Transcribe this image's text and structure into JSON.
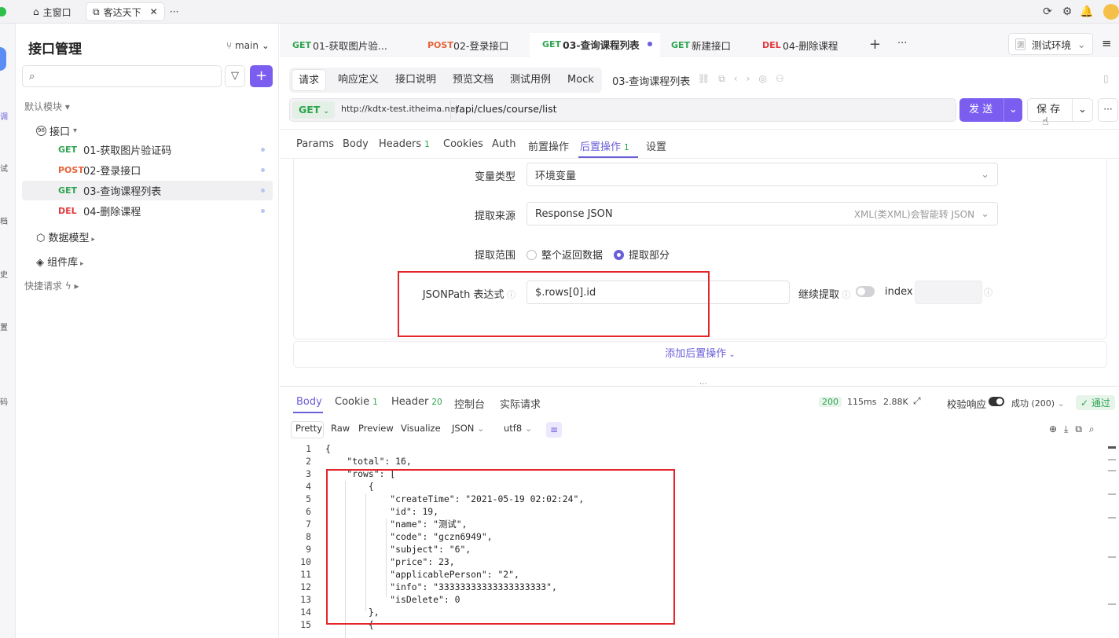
{
  "window_tabs": [
    {
      "label": "主窗口",
      "icon": "home-icon"
    },
    {
      "label": "客达天下",
      "icon": "external-link-icon"
    }
  ],
  "window_more": "···",
  "rail_labels": [
    "调",
    "试",
    "档",
    "史",
    "置",
    "码"
  ],
  "sidebar": {
    "title": "接口管理",
    "branch": "main",
    "search_placeholder": "",
    "default_module": "默认模块",
    "api_group": "接口",
    "items": [
      {
        "method": "GET",
        "label": "01-获取图片验证码"
      },
      {
        "method": "POST",
        "label": "02-登录接口"
      },
      {
        "method": "GET",
        "label": "03-查询课程列表"
      },
      {
        "method": "DEL",
        "label": "04-删除课程"
      }
    ],
    "data_models": "数据模型",
    "components": "组件库",
    "quick_requests": "快捷请求"
  },
  "request_tabs": [
    {
      "method": "GET",
      "label": "01-获取图片验..."
    },
    {
      "method": "POST",
      "label": "02-登录接口"
    },
    {
      "method": "GET",
      "label": "03-查询课程列表"
    },
    {
      "method": "GET",
      "label": "新建接口"
    },
    {
      "method": "DEL",
      "label": "04-删除课程"
    }
  ],
  "env_label": "测试环境",
  "env_badge": "测",
  "sub_tabs": [
    "请求",
    "响应定义",
    "接口说明",
    "预览文档",
    "测试用例",
    "Mock"
  ],
  "api_name": "03-查询课程列表",
  "url_bar": {
    "method": "GET",
    "base": "http://kdtx-test.itheima.net",
    "path": "/api/clues/course/list",
    "send_label": "发 送",
    "save_label": "保 存"
  },
  "param_tabs": [
    {
      "label": "Params"
    },
    {
      "label": "Body"
    },
    {
      "label": "Headers",
      "badge": "1"
    },
    {
      "label": "Cookies"
    },
    {
      "label": "Auth"
    },
    {
      "label": "前置操作"
    },
    {
      "label": "后置操作",
      "badge": "1"
    },
    {
      "label": "设置"
    }
  ],
  "post_op": {
    "var_type_label": "变量类型",
    "var_type_value": "环境变量",
    "source_label": "提取来源",
    "source_value": "Response JSON",
    "source_hint": "XML(类XML)会智能转 JSON",
    "scope_label": "提取范围",
    "scope_options": [
      "整个返回数据",
      "提取部分"
    ],
    "jsonpath_label": "JSONPath 表达式",
    "jsonpath_value": "$.rows[0].id",
    "continue_label": "继续提取",
    "index_label": "index",
    "add_label": "添加后置操作"
  },
  "response": {
    "tabs": [
      {
        "label": "Body"
      },
      {
        "label": "Cookie",
        "badge": "1"
      },
      {
        "label": "Header",
        "badge": "20"
      },
      {
        "label": "控制台"
      },
      {
        "label": "实际请求"
      }
    ],
    "status_code": "200",
    "time": "115ms",
    "size": "2.88K",
    "validate_label": "校验响应",
    "success_label": "成功 (200)",
    "pass_label": "通过",
    "formats": [
      "Pretty",
      "Raw",
      "Preview",
      "Visualize"
    ],
    "lang": "JSON",
    "encoding": "utf8",
    "code_lines": [
      "{",
      "    \"total\": 16,",
      "    \"rows\": [",
      "        {",
      "            \"createTime\": \"2021-05-19 02:02:24\",",
      "            \"id\": 19,",
      "            \"name\": \"测试\",",
      "            \"code\": \"gczn6949\",",
      "            \"subject\": \"6\",",
      "            \"price\": 23,",
      "            \"applicablePerson\": \"2\",",
      "            \"info\": \"33333333333333333333\",",
      "            \"isDelete\": 0",
      "        },",
      "        {"
    ]
  },
  "colors": {
    "accent": "#6a5fd8",
    "get": "#2da44e",
    "post": "#e5623a",
    "del": "#e0383e",
    "highlight_box": "#e4262b"
  }
}
